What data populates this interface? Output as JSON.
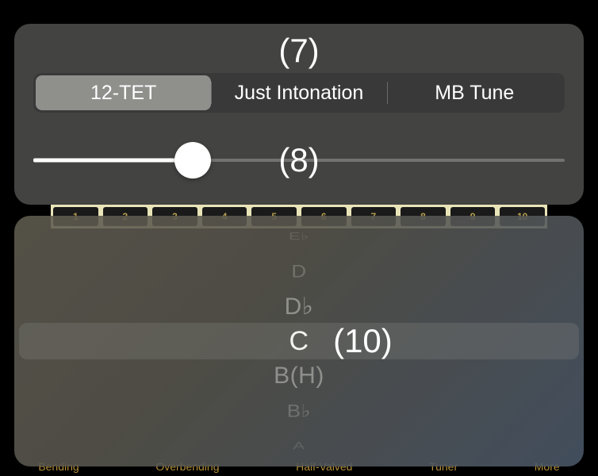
{
  "overlays": {
    "label7": "(7)",
    "label8": "(8)",
    "label10": "(10)"
  },
  "tuning": {
    "segments": [
      {
        "label": "12-TET",
        "selected": true
      },
      {
        "label": "Just Intonation",
        "selected": false
      },
      {
        "label": "MB Tune",
        "selected": false
      }
    ],
    "slider_percent": 30
  },
  "harmonica": {
    "holes": [
      "1",
      "2",
      "3",
      "4",
      "5",
      "6",
      "7",
      "8",
      "9",
      "10"
    ]
  },
  "picker": {
    "items": [
      "E♭",
      "D",
      "D♭",
      "C",
      "B(H)",
      "B♭",
      "A"
    ],
    "selected_index": 3
  },
  "bottom_bar": {
    "items": [
      "Bending",
      "Overbending",
      "Half-Valved",
      "Tuner",
      "More"
    ]
  }
}
